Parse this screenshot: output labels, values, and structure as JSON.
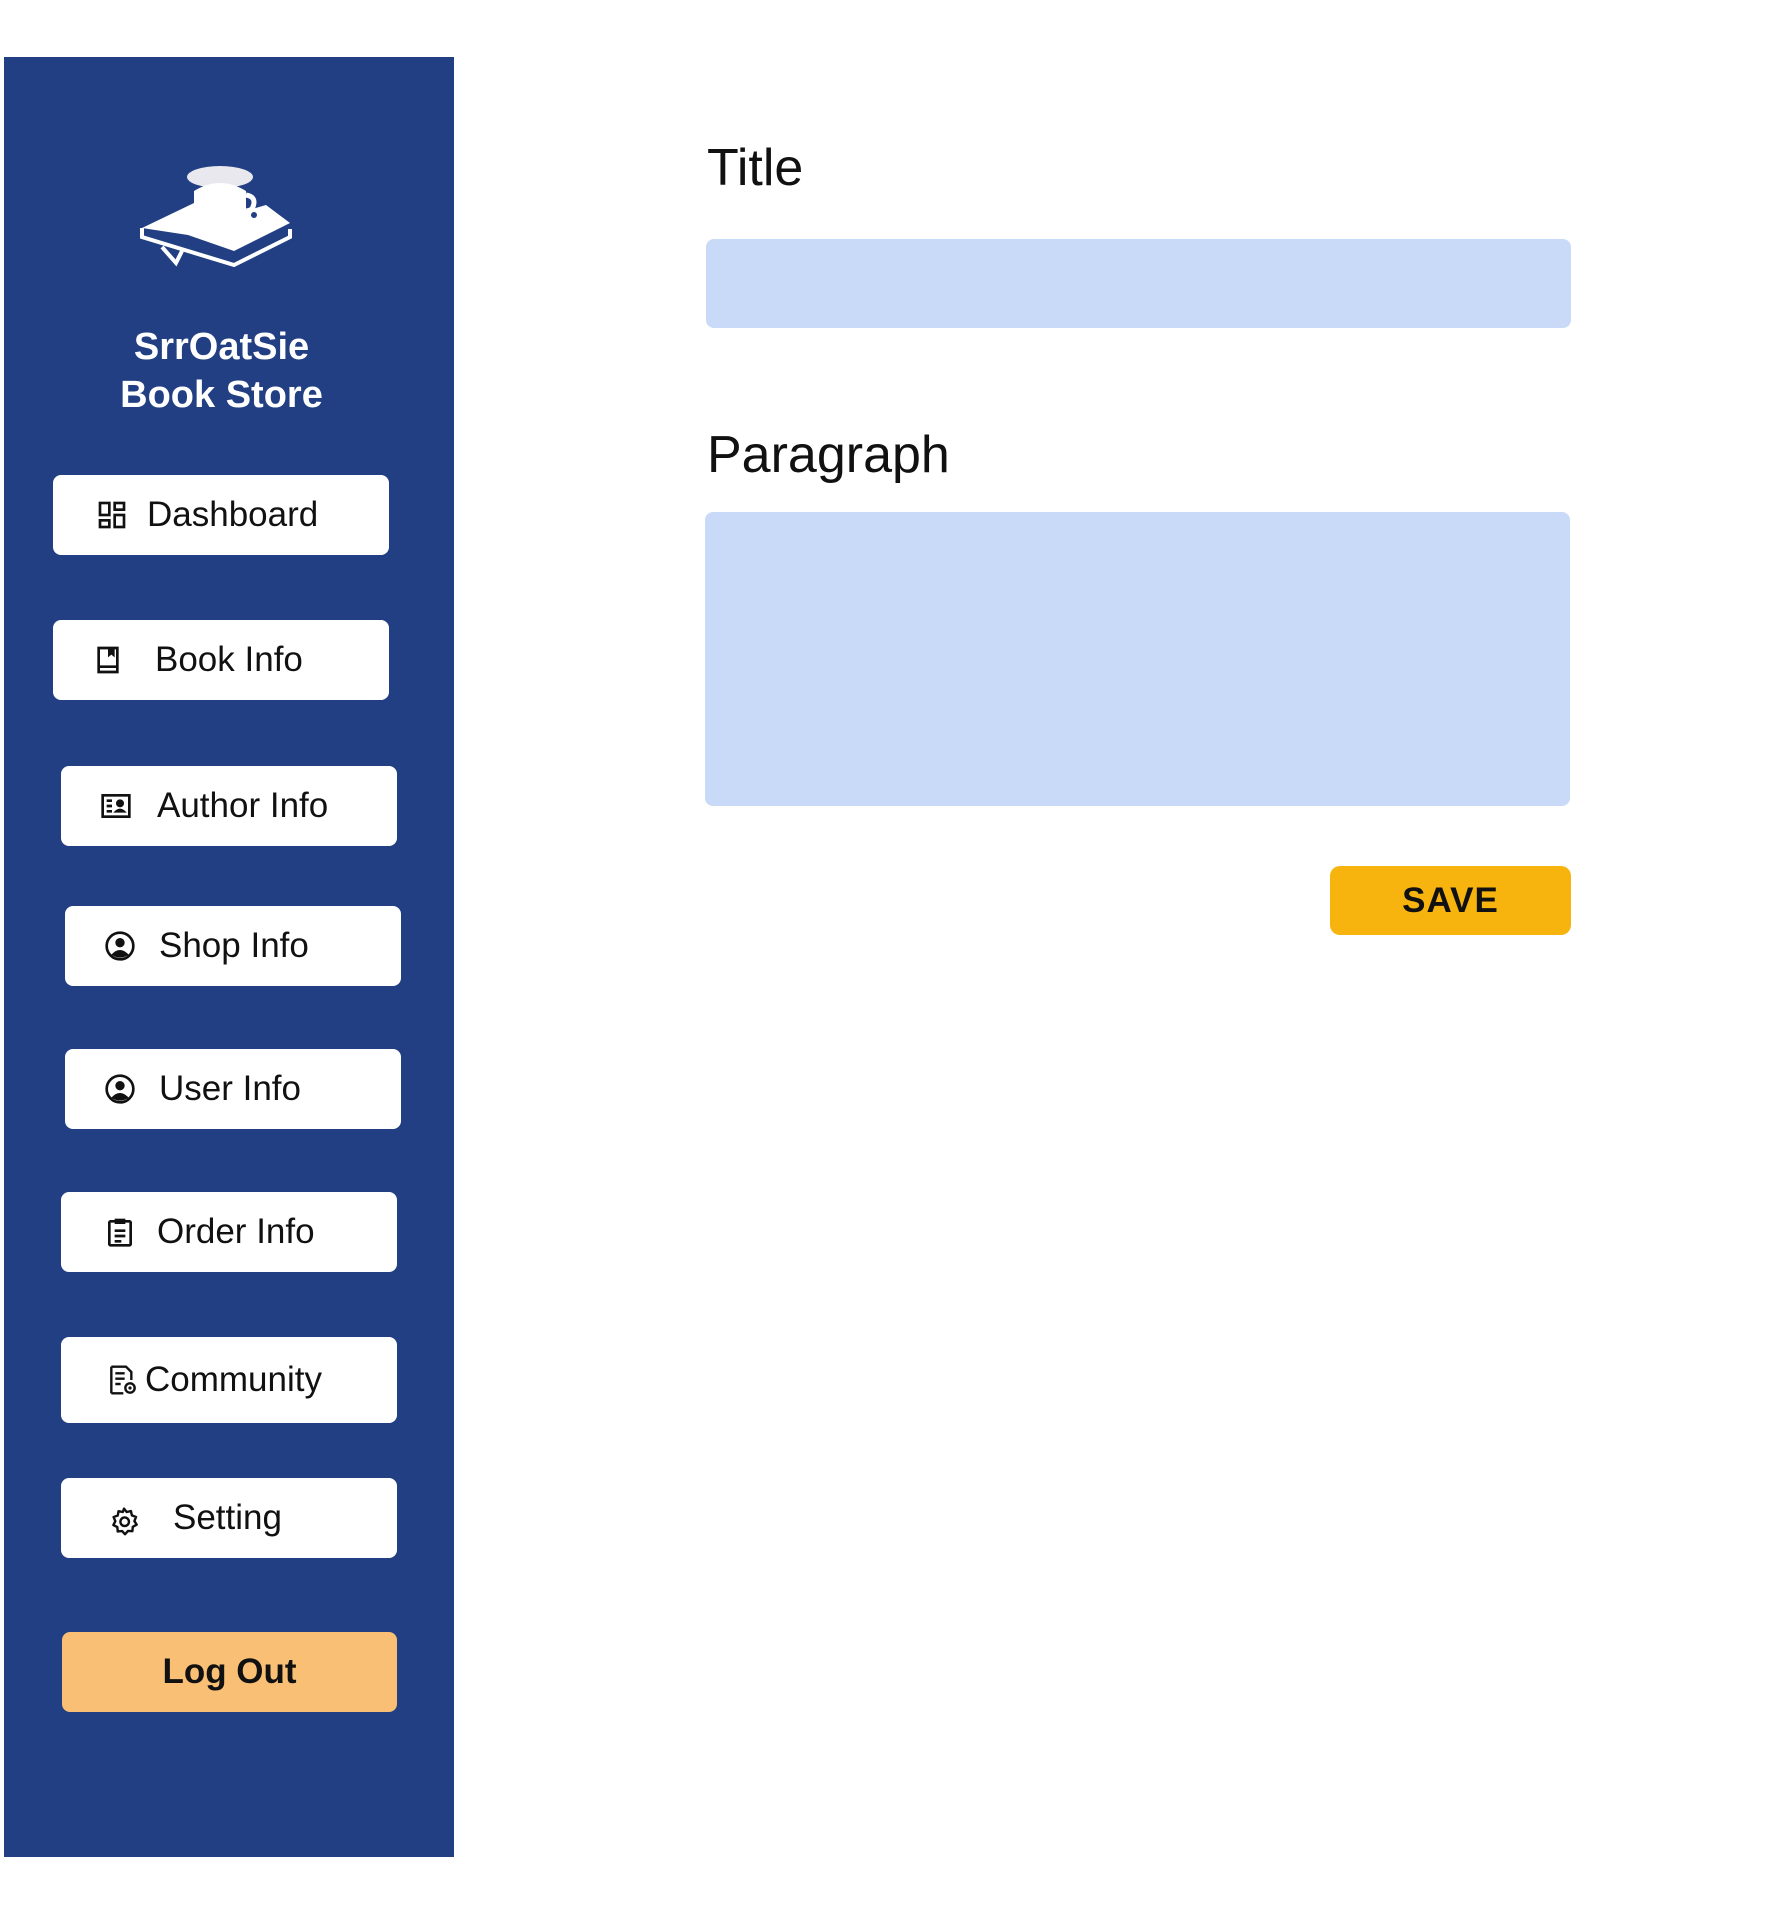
{
  "sidebar": {
    "brand_line1": "SrrOatSie",
    "brand_line2": "Book Store",
    "logo_icon": "book-with-cup-icon",
    "items": [
      {
        "label": "Dashboard",
        "icon": "dashboard-grid-icon"
      },
      {
        "label": "Book Info",
        "icon": "book-icon"
      },
      {
        "label": "Author Info",
        "icon": "contact-card-icon"
      },
      {
        "label": "Shop Info",
        "icon": "user-circle-icon"
      },
      {
        "label": "User Info",
        "icon": "user-circle-icon"
      },
      {
        "label": "Order Info",
        "icon": "clipboard-icon"
      },
      {
        "label": "Community",
        "icon": "document-settings-icon"
      },
      {
        "label": "Setting",
        "icon": "gear-icon"
      }
    ],
    "logout_label": "Log Out"
  },
  "form": {
    "title_label": "Title",
    "title_value": "",
    "paragraph_label": "Paragraph",
    "paragraph_value": "",
    "save_label": "SAVE"
  },
  "colors": {
    "sidebar_bg": "#213f82",
    "input_bg": "#c9daf8",
    "save_bg": "#f7b40f",
    "logout_bg": "#f9c075"
  }
}
